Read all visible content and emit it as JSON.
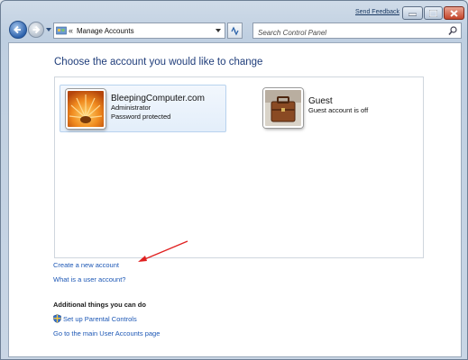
{
  "titlebar": {
    "send_feedback": "Send Feedback"
  },
  "address_bar": {
    "chevron": "«",
    "location": "Manage Accounts"
  },
  "search": {
    "placeholder": "Search Control Panel"
  },
  "main": {
    "heading": "Choose the account you would like to change",
    "accounts": [
      {
        "name": "BleepingComputer.com",
        "line1": "Administrator",
        "line2": "Password protected",
        "picture": "orange-flower-picture",
        "selected": true
      },
      {
        "name": "Guest",
        "line1": "Guest account is off",
        "picture": "briefcase-picture",
        "selected": false
      }
    ],
    "links": {
      "create": "Create a new account",
      "what": "What is a user account?"
    },
    "additional": {
      "heading": "Additional things you can do",
      "parental": "Set up Parental Controls",
      "main_page": "Go to the main User Accounts page"
    }
  },
  "annotation": {
    "arrow_color": "#e02020"
  },
  "icons": [
    "back-arrow-icon",
    "forward-arrow-icon",
    "control-panel-icon",
    "refresh-icon",
    "search-icon",
    "shield-icon",
    "minimize-icon",
    "maximize-icon",
    "close-icon"
  ]
}
